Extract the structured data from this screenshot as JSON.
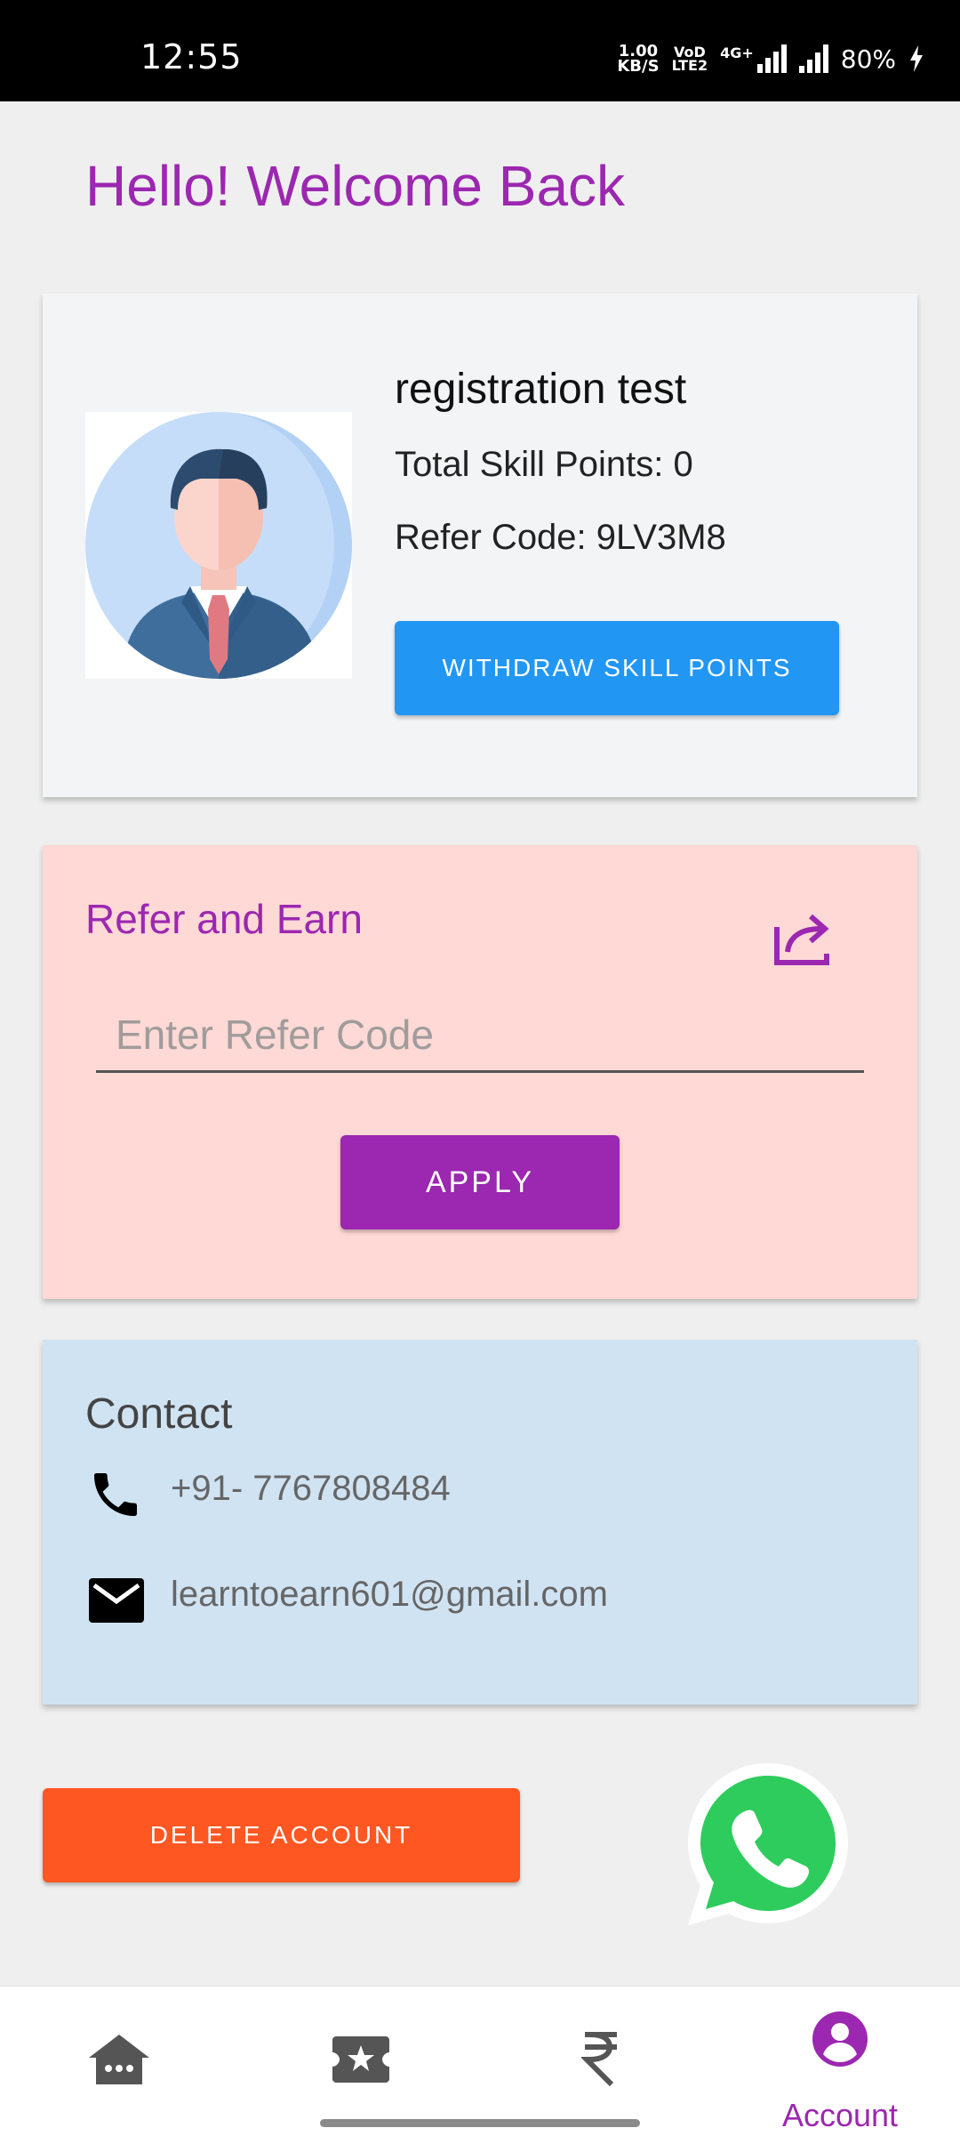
{
  "status_bar": {
    "time": "12:55",
    "speed_value": "1.00",
    "speed_unit": "KB/S",
    "volte_top": "VoD",
    "volte_bottom": "LTE2",
    "network": "4G+",
    "battery": "80%"
  },
  "header": {
    "welcome": "Hello! Welcome Back"
  },
  "profile": {
    "name": "registration test",
    "skill_points": "Total Skill Points: 0",
    "refer_code": "Refer Code: 9LV3M8",
    "withdraw_label": "WITHDRAW SKILL POINTS"
  },
  "refer": {
    "title": "Refer and Earn",
    "input_placeholder": "Enter Refer Code",
    "input_value": "",
    "apply_label": "APPLY"
  },
  "contact": {
    "title": "Contact",
    "phone": "+91- 7767808484",
    "email": "learntoearn601@gmail.com"
  },
  "actions": {
    "delete_label": "DELETE ACCOUNT"
  },
  "bottom_nav": {
    "items": [
      {
        "icon": "home-chat-icon",
        "label": ""
      },
      {
        "icon": "ticket-star-icon",
        "label": ""
      },
      {
        "icon": "rupee-icon",
        "label": ""
      },
      {
        "icon": "account-icon",
        "label": "Account",
        "active": true
      }
    ]
  },
  "colors": {
    "accent": "#9c27b0",
    "withdraw": "#2196f3",
    "delete": "#ff5722",
    "refer_bg": "#ffd9d6",
    "contact_bg": "#d0e3f3",
    "whatsapp": "#25d366"
  }
}
